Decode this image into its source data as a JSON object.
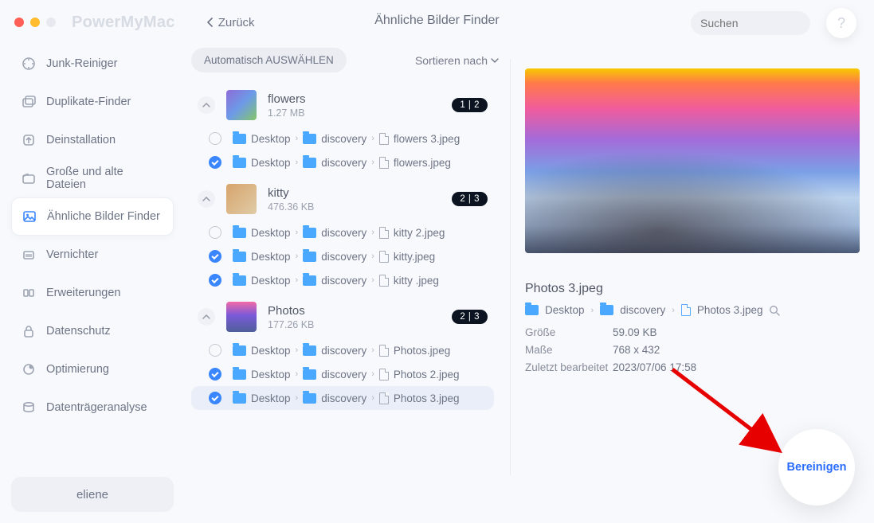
{
  "app_name": "PowerMyMac",
  "back_label": "Zurück",
  "window_title": "Ähnliche Bilder Finder",
  "search_placeholder": "Suchen",
  "help_glyph": "?",
  "sidebar": {
    "items": [
      {
        "label": "Junk-Reiniger",
        "active": false
      },
      {
        "label": "Duplikate-Finder",
        "active": false
      },
      {
        "label": "Deinstallation",
        "active": false
      },
      {
        "label": "Große und alte Dateien",
        "active": false
      },
      {
        "label": "Ähnliche Bilder Finder",
        "active": true
      },
      {
        "label": "Vernichter",
        "active": false
      },
      {
        "label": "Erweiterungen",
        "active": false
      },
      {
        "label": "Datenschutz",
        "active": false
      },
      {
        "label": "Optimierung",
        "active": false
      },
      {
        "label": "Datenträgeranalyse",
        "active": false
      }
    ],
    "user": "eliene"
  },
  "toolbar": {
    "auto_select": "Automatisch AUSWÄHLEN",
    "sort_label": "Sortieren nach"
  },
  "path_segments": {
    "desktop": "Desktop",
    "discovery": "discovery"
  },
  "groups": [
    {
      "title": "flowers",
      "size": "1.27 MB",
      "badge": "1 | 2",
      "files": [
        {
          "name": "flowers 3.jpeg",
          "checked": false,
          "selected": false
        },
        {
          "name": "flowers.jpeg",
          "checked": true,
          "selected": false
        }
      ]
    },
    {
      "title": "kitty",
      "size": "476.36 KB",
      "badge": "2 | 3",
      "files": [
        {
          "name": "kitty 2.jpeg",
          "checked": false,
          "selected": false
        },
        {
          "name": "kitty.jpeg",
          "checked": true,
          "selected": false
        },
        {
          "name": "kitty .jpeg",
          "checked": true,
          "selected": false
        }
      ]
    },
    {
      "title": "Photos",
      "size": "177.26 KB",
      "badge": "2 | 3",
      "files": [
        {
          "name": "Photos.jpeg",
          "checked": false,
          "selected": false
        },
        {
          "name": "Photos 2.jpeg",
          "checked": true,
          "selected": false
        },
        {
          "name": "Photos 3.jpeg",
          "checked": true,
          "selected": true
        }
      ]
    }
  ],
  "detail": {
    "filename": "Photos 3.jpeg",
    "path": [
      "Desktop",
      "discovery",
      "Photos 3.jpeg"
    ],
    "meta": {
      "size_k": "Größe",
      "size_v": "59.09 KB",
      "dim_k": "Maße",
      "dim_v": "768 x 432",
      "mod_k": "Zuletzt bearbeitet",
      "mod_v": "2023/07/06 17:58"
    }
  },
  "clean_label": "Bereinigen"
}
